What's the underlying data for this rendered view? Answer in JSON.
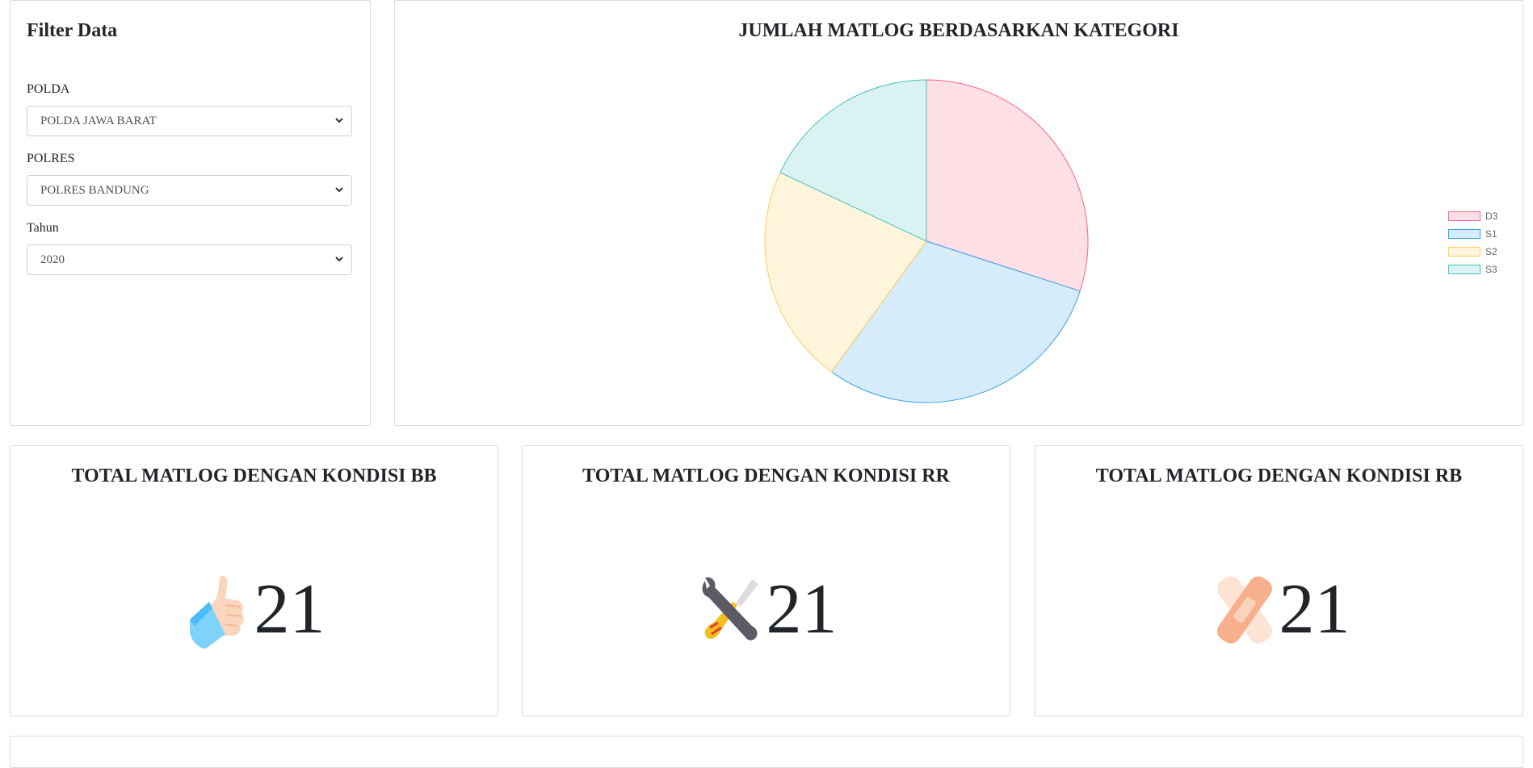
{
  "filter": {
    "title": "Filter Data",
    "polda": {
      "label": "POLDA",
      "value": "POLDA JAWA BARAT"
    },
    "polres": {
      "label": "POLRES",
      "value": "POLRES BANDUNG"
    },
    "tahun": {
      "label": "Tahun",
      "value": "2020"
    }
  },
  "chart_data": {
    "type": "pie",
    "title": "JUMLAH MATLOG BERDASARKAN KATEGORI",
    "categories": [
      "D3",
      "S1",
      "S2",
      "S3"
    ],
    "values": [
      30,
      30,
      22,
      18
    ],
    "colors": [
      {
        "fill": "#ffe0e6",
        "stroke": "#ff6384"
      },
      {
        "fill": "#d7ecfb",
        "stroke": "#36a2eb"
      },
      {
        "fill": "#fff5dd",
        "stroke": "#ffce56"
      },
      {
        "fill": "#dbf2f2",
        "stroke": "#4bc0c0"
      }
    ],
    "legend_position": "right"
  },
  "stats": {
    "bb": {
      "title": "TOTAL MATLOG DENGAN KONDISI BB",
      "value": "21",
      "icon": "thumbs-up-icon"
    },
    "rr": {
      "title": "TOTAL MATLOG DENGAN KONDISI RR",
      "value": "21",
      "icon": "wrench-screwdriver-icon"
    },
    "rb": {
      "title": "TOTAL MATLOG DENGAN KONDISI RB",
      "value": "21",
      "icon": "bandage-icon"
    }
  }
}
